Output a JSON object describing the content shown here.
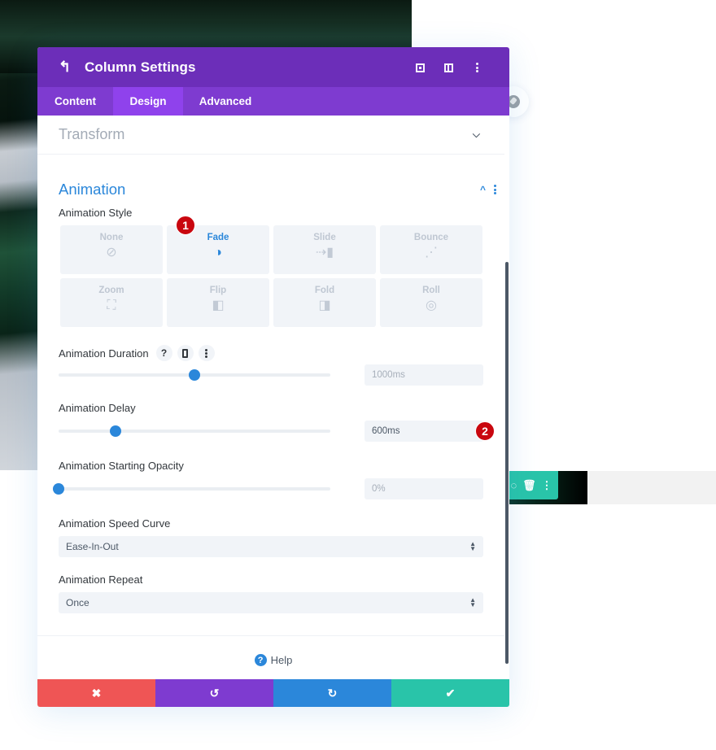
{
  "modal": {
    "title": "Column Settings",
    "header_icons": [
      "back-arrow-icon",
      "focus-mode-icon",
      "split-view-icon",
      "more-options-icon"
    ],
    "tabs": [
      {
        "label": "Content",
        "active": false
      },
      {
        "label": "Design",
        "active": true
      },
      {
        "label": "Advanced",
        "active": false
      }
    ],
    "sections": {
      "transform": {
        "title": "Transform",
        "expanded": false
      },
      "animation": {
        "title": "Animation",
        "expanded": true
      }
    },
    "animation": {
      "style_label": "Animation Style",
      "styles": [
        {
          "label": "None",
          "icon": "⊘",
          "active": false
        },
        {
          "label": "Fade",
          "icon": "◑",
          "active": true
        },
        {
          "label": "Slide",
          "icon": "⇢▮",
          "active": false
        },
        {
          "label": "Bounce",
          "icon": "⋰",
          "active": false
        },
        {
          "label": "Zoom",
          "icon": "⛶",
          "active": false
        },
        {
          "label": "Flip",
          "icon": "◧",
          "active": false
        },
        {
          "label": "Fold",
          "icon": "◨",
          "active": false
        },
        {
          "label": "Roll",
          "icon": "◎",
          "active": false
        }
      ],
      "duration": {
        "label": "Animation Duration",
        "value": "1000ms",
        "slider_fraction": 0.5
      },
      "delay": {
        "label": "Animation Delay",
        "value": "600ms",
        "slider_fraction": 0.21
      },
      "opacity": {
        "label": "Animation Starting Opacity",
        "value": "0%",
        "slider_fraction": 0.0
      },
      "speed_curve": {
        "label": "Animation Speed Curve",
        "value": "Ease-In-Out"
      },
      "repeat": {
        "label": "Animation Repeat",
        "value": "Once"
      }
    },
    "label_icons": {
      "help": "?",
      "dots": "⋮"
    },
    "help_label": "Help",
    "footer": {
      "cancel": "✖",
      "undo": "↺",
      "redo": "↻",
      "save": "✔"
    }
  },
  "badges": {
    "one": "1",
    "two": "2"
  },
  "colors": {
    "header": "#6c2eb9",
    "tabs": "#7e3bd0",
    "active_tab": "#8f42ec",
    "accent": "#2b87da",
    "cancel": "#ef5555",
    "save": "#29c4a9",
    "badge": "#c9070f"
  }
}
